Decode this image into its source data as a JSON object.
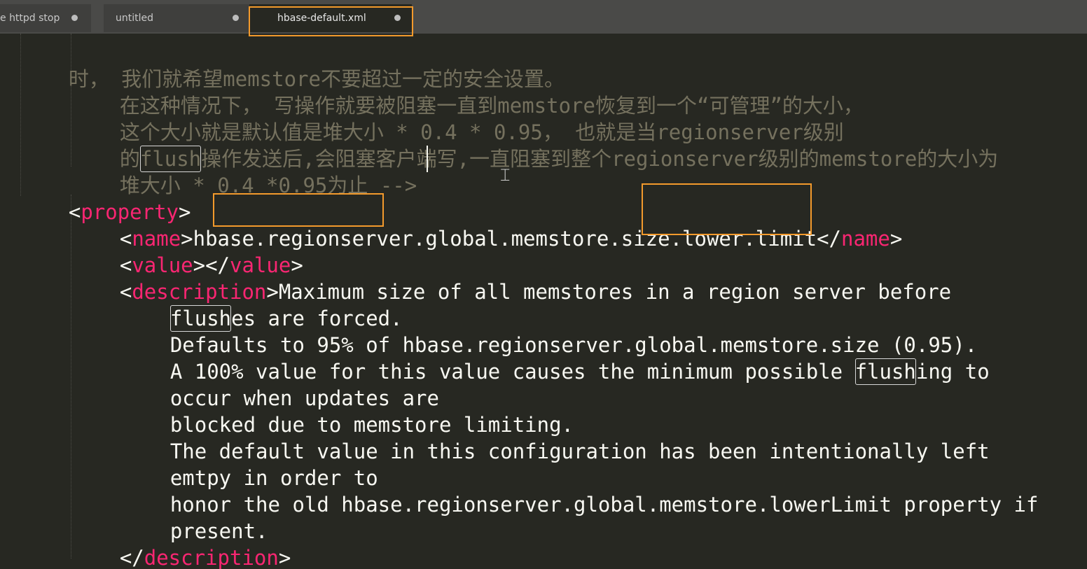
{
  "tabs": [
    {
      "label": "e httpd stop",
      "dirty": true,
      "active": false
    },
    {
      "label": "untitled",
      "dirty": true,
      "active": false
    },
    {
      "label": "hbase-default.xml",
      "dirty": true,
      "active": true
    }
  ],
  "editor": {
    "comment_lines": [
      "时， 我们就希望memstore不要超过一定的安全设置。",
      "在这种情况下， 写操作就要被阻塞一直到memstore恢复到一个“可管理”的大小，",
      "这个大小就是默认值是堆大小 * 0.4 * 0.95， 也就是当regionserver级别",
      "操作发送后,会阻塞客户端写,一直阻塞到整个regionserver级别的memstore的大小为",
      "堆大小 * 0.4 *0.95为止 -->"
    ],
    "comment_line4_prefix": "的",
    "comment_line4_match": "flush",
    "property_tag": "property",
    "name_tag": "name",
    "value_tag": "value",
    "description_tag": "description",
    "name_text": {
      "part1": "hbase",
      "part2": ".regionserver",
      "part3": ".global.memstore.size",
      "part4": ".lower.limit"
    },
    "desc_first": "Maximum size of all memstores in a region server before",
    "desc_line2_match": "flush",
    "desc_line2_rest": "es are forced.",
    "desc_line3": "Defaults to 95% of hbase.regionserver.global.memstore.size (0.95).",
    "desc_line4_pre": "A 100% value for this value causes the minimum possible ",
    "desc_line4_match": "flush",
    "desc_line4_post": "ing to",
    "desc_lines_rest": [
      "occur when updates are",
      "blocked due to memstore limiting.",
      "The default value in this configuration has been intentionally left",
      "emtpy in order to",
      "honor the old hbase.regionserver.global.memstore.lowerLimit property if",
      "present."
    ]
  },
  "colors": {
    "background": "#272822",
    "tag": "#f92672",
    "comment": "#75715e",
    "text": "#f8f8f2",
    "highlight_box": "#f39a2c"
  }
}
